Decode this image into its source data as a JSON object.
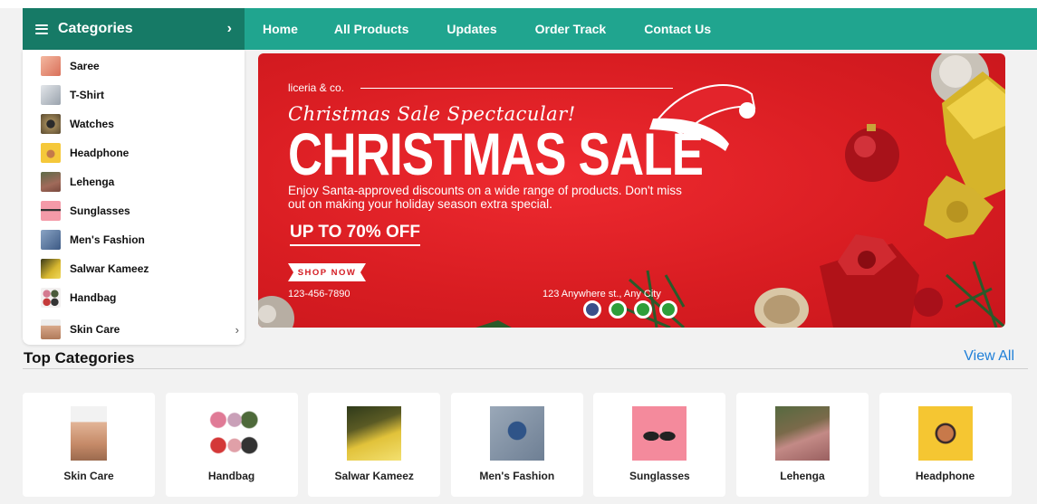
{
  "navbar": {
    "categories_label": "Categories",
    "links": [
      "Home",
      "All Products",
      "Updates",
      "Order Track",
      "Contact Us"
    ]
  },
  "sidebar": {
    "items": [
      {
        "label": "Saree",
        "icon": "saree-thumb",
        "color": "#e9967a"
      },
      {
        "label": "T-Shirt",
        "icon": "tshirt-thumb",
        "color": "#c9cfd6"
      },
      {
        "label": "Watches",
        "icon": "watches-thumb",
        "color": "#6b5a3c"
      },
      {
        "label": "Headphone",
        "icon": "headphone-thumb",
        "color": "#f2c230"
      },
      {
        "label": "Lehenga",
        "icon": "lehenga-thumb",
        "color": "#8a5a4a"
      },
      {
        "label": "Sunglasses",
        "icon": "sunglasses-thumb",
        "color": "#f08fa0"
      },
      {
        "label": "Men's Fashion",
        "icon": "mens-fashion-thumb",
        "color": "#5a78a0"
      },
      {
        "label": "Salwar Kameez",
        "icon": "salwar-kameez-thumb",
        "color": "#c8a020"
      },
      {
        "label": "Handbag",
        "icon": "handbag-thumb",
        "color": "#c07a90"
      },
      {
        "label": "Skin Care",
        "icon": "skin-care-thumb",
        "color": "#caa58a"
      }
    ]
  },
  "banner": {
    "brand": "liceria & co.",
    "script_title": "Christmas Sale Spectacular!",
    "headline": "CHRISTMAS SALE",
    "description": "Enjoy Santa-approved discounts on a wide range of products. Don't miss out on making your holiday season extra special.",
    "offer": "UP TO 70% OFF",
    "cta": "SHOP NOW",
    "phone": "123-456-7890",
    "address": "123 Anywhere st., Any City",
    "background_color": "#d91d22",
    "slider_dots": [
      {
        "color": "#3a4f8a",
        "active": true
      },
      {
        "color": "#2e9e3a",
        "active": false
      },
      {
        "color": "#2e9e3a",
        "active": false
      },
      {
        "color": "#2e9e3a",
        "active": false
      }
    ]
  },
  "top_categories": {
    "title": "Top Categories",
    "view_all": "View All",
    "cards": [
      {
        "label": "Skin Care",
        "icon": "skin-care-image"
      },
      {
        "label": "Handbag",
        "icon": "handbag-image"
      },
      {
        "label": "Salwar Kameez",
        "icon": "salwar-kameez-image"
      },
      {
        "label": "Men's Fashion",
        "icon": "mens-fashion-image"
      },
      {
        "label": "Sunglasses",
        "icon": "sunglasses-image"
      },
      {
        "label": "Lehenga",
        "icon": "lehenga-image"
      },
      {
        "label": "Headphone",
        "icon": "headphone-image"
      }
    ]
  },
  "colors": {
    "nav_bar": "#20a58f",
    "category_header": "#167a66",
    "link_blue": "#1e7fd8"
  }
}
